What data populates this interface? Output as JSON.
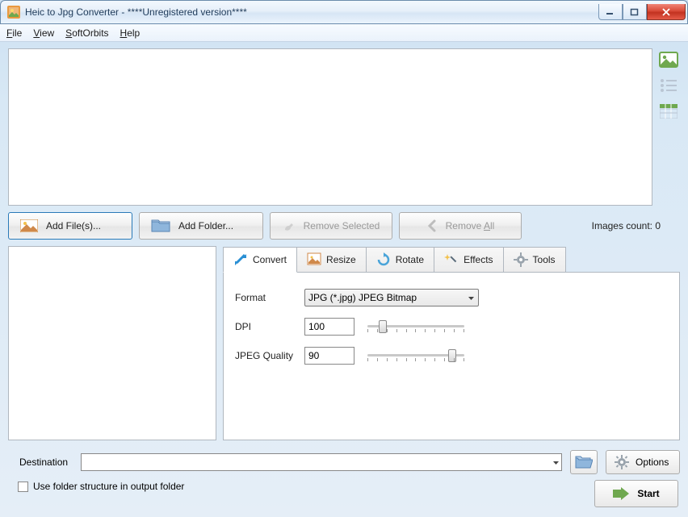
{
  "window": {
    "title": "Heic to Jpg Converter - ****Unregistered version****"
  },
  "menu": {
    "file": "File",
    "view": "View",
    "softorbits": "SoftOrbits",
    "help": "Help"
  },
  "buttons": {
    "add_files": "Add File(s)...",
    "add_folder": "Add Folder...",
    "remove_selected": "Remove Selected",
    "remove_all": "Remove All",
    "options": "Options",
    "start": "Start"
  },
  "status": {
    "images_count_label": "Images count: 0"
  },
  "tabs": {
    "convert": "Convert",
    "resize": "Resize",
    "rotate": "Rotate",
    "effects": "Effects",
    "tools": "Tools"
  },
  "form": {
    "format_label": "Format",
    "format_value": "JPG (*.jpg) JPEG Bitmap",
    "dpi_label": "DPI",
    "dpi_value": "100",
    "quality_label": "JPEG Quality",
    "quality_value": "90"
  },
  "dest": {
    "label": "Destination",
    "value": "",
    "checkbox_label": "Use folder structure in output folder"
  }
}
